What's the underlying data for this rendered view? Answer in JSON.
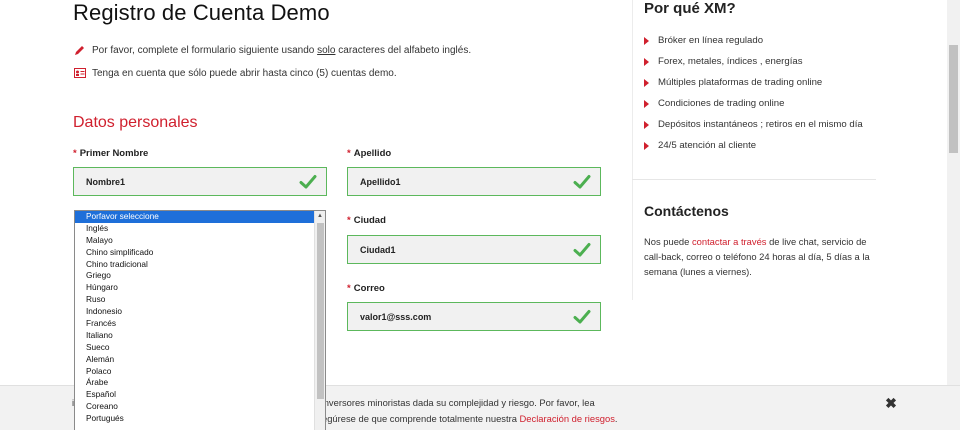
{
  "page": {
    "title": "Registro de Cuenta Demo",
    "note1_pre": "Por favor, complete el formulario siguiente usando ",
    "note1_underline": "solo",
    "note1_post": " caracteres del alfabeto inglés.",
    "note2": "Tenga en cuenta que sólo puede abrir hasta cinco (5) cuentas demo."
  },
  "form": {
    "section_title": "Datos personales",
    "required_mark": "*",
    "first_name_label": "Primer Nombre",
    "first_name_value": "Nombre1",
    "last_name_label": "Apellido",
    "last_name_value": "Apellido1",
    "city_label": "Ciudad",
    "city_value": "Ciudad1",
    "email_label": "Correo",
    "email_value": "valor1@sss.com",
    "valid_color": "#5cb85c"
  },
  "dropdown": {
    "selected": "Porfavor seleccione",
    "options": [
      "Inglés",
      "Malayo",
      "Chino simplificado",
      "Chino tradicional",
      "Griego",
      "Húngaro",
      "Ruso",
      "Indonesio",
      "Francés",
      "Italiano",
      "Sueco",
      "Alemán",
      "Polaco",
      "Árabe",
      "Español",
      "Coreano",
      "Portugués"
    ]
  },
  "sidebar": {
    "why_title": "Por qué XM?",
    "why_items": [
      "Bróker en línea regulado",
      "Forex, metales, índices , energías",
      "Múltiples plataformas de trading online",
      "Condiciones de trading online",
      "Depósitos instantáneos ; retiros en el mismo día",
      "24/5 atención al cliente"
    ],
    "contact_title": "Contáctenos",
    "contact_pre": "Nos puede ",
    "contact_link": "contactar a través",
    "contact_post": " de live chat, servicio de call-back, correo o teléfono 24 horas al día, 5 días a la semana (lunes a viernes)."
  },
  "banner": {
    "line1": "il de comprender y la CNMV cree que no es adecuado para inversores minoristas dada su complejidad y riesgo. Por favor, lea",
    "line2_pre": "egúrese de que comprende totalmente nuestra ",
    "line2_link": "Declaración de riesgos",
    "line2_post": ".",
    "close_glyph": "✖"
  },
  "colors": {
    "accent": "#d0202e",
    "selection": "#1e6fd9"
  }
}
